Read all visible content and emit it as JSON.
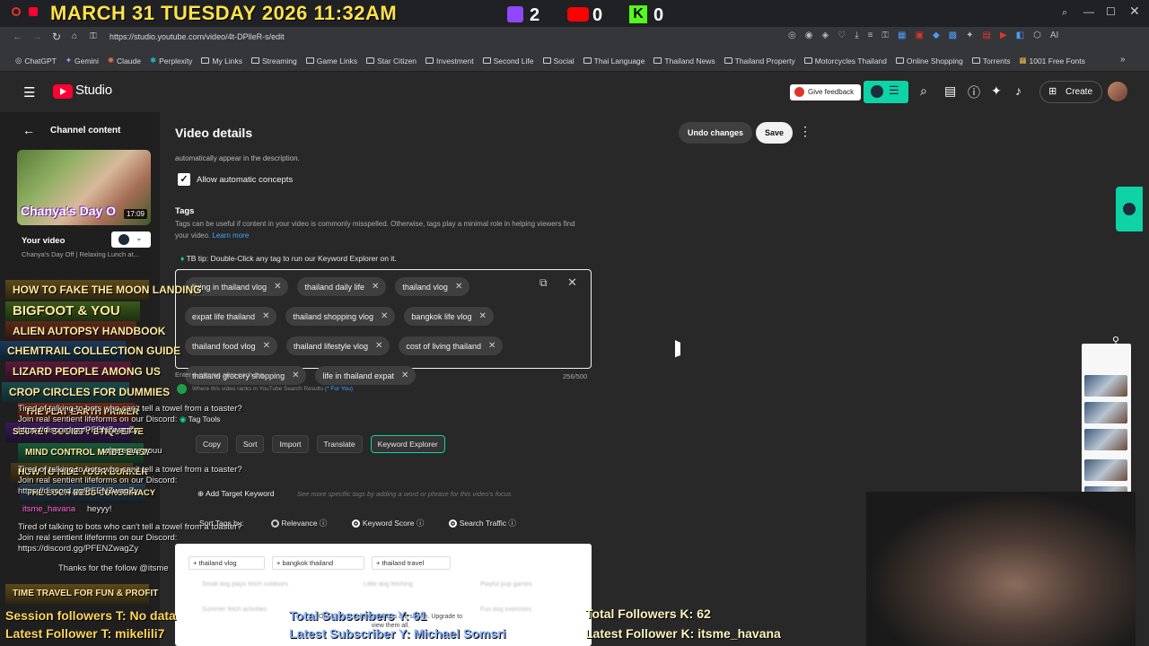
{
  "overlay": {
    "datetime": "MARCH 31 TUESDAY 2026 11:32AM",
    "twitch_count": "2",
    "youtube_count": "0",
    "kick_count": "0",
    "session_followers": "Session followers T: No data",
    "latest_follower_t": "Latest Follower T: mikelili7",
    "total_subscribers": "Total Subscribers Y: 61",
    "latest_subscriber": "Latest Subscriber Y: Michael Somsri",
    "total_followers_k": "Total Followers K: 62",
    "latest_follower_k": "Latest Follower K: itsme_havana"
  },
  "browser": {
    "url": "https://studio.youtube.com/video/4t-DPlleR-s/edit",
    "bookmarks": [
      "ChatGPT",
      "Gemini",
      "Claude",
      "Perplexity",
      "My Links",
      "Streaming",
      "Game Links",
      "Star Citizen",
      "Investment",
      "Second Life",
      "Social",
      "Thai Language",
      "Thailand News",
      "Thailand Property",
      "Motorcycles Thailand",
      "Online Shopping",
      "Torrents",
      "1001 Free Fonts"
    ]
  },
  "studio": {
    "logo_text": "Studio",
    "give_feedback": "Give feedback",
    "create": "Create",
    "channel_content": "Channel content",
    "your_video": "Your video",
    "video_title_short": "Chanya's Day Off | Relaxing Lunch at...",
    "thumb_caption": "Chanya's Day O",
    "thumb_duration": "17:09"
  },
  "details": {
    "title": "Video details",
    "undo": "Undo changes",
    "save": "Save",
    "auto_note": "automatically appear in the description.",
    "allow_concepts": "Allow automatic concepts",
    "tags_heading": "Tags",
    "tags_desc": "Tags can be useful if content in your video is commonly misspelled. Otherwise, tags play a minimal role in helping viewers find your video.",
    "learn_more": "Learn more",
    "tb_tip": "TB tip: Double-Click any tag to run our Keyword Explorer on it.",
    "tags": [
      "living in thailand vlog",
      "thailand daily life",
      "thailand vlog",
      "expat life thailand",
      "thailand shopping vlog",
      "bangkok life vlog",
      "thailand food vlog",
      "thailand lifestyle vlog",
      "cost of living thailand",
      "thailand grocery shopping",
      "life in thailand expat"
    ],
    "comma_hint": "Enter a comma after each tag",
    "counter": "256/500",
    "rank_note": "Where this video ranks in YouTube Search Results",
    "for_you": "(* For You)",
    "tag_tools": "Tag Tools",
    "tool_buttons": [
      "Copy",
      "Sort",
      "Import",
      "Translate",
      "Keyword Explorer"
    ],
    "add_target": "Add Target Keyword",
    "add_target_hint": "See more specific tags by adding a word or phrase for this video's focus",
    "sort_by": "Sort Tags by:",
    "sort_options": [
      "Relevance",
      "Keyword Score",
      "Search Traffic"
    ],
    "suggested": [
      "thailand vlog",
      "bangkok thailand",
      "thailand travel"
    ],
    "blurred_rows": [
      "Small dog plays fetch outdoors",
      "Little dog fetching",
      "Playful pup games",
      "Summer fetch activities",
      "Fun dog exercises"
    ],
    "upgrade_note": "Only 3 of 12 suggested tags are shown. Upgrade to view them all."
  },
  "chat": [
    {
      "user": "",
      "text": "Tired of talking to bots who can't tell a towel from a toaster? Join real sentient lifeforms on our Discord: https://discord.gg/PFENZwagZy"
    },
    {
      "user": "",
      "text": "where are youu"
    },
    {
      "user": "itsme_havana",
      "text": "heyyy!"
    },
    {
      "user": "",
      "text": "Thanks for the follow @itsme"
    }
  ],
  "books": [
    "HOW TO FAKE THE MOON LANDING",
    "BIGFOOT & YOU",
    "ALIEN AUTOPSY HANDBOOK",
    "CHEMTRAIL COLLECTION GUIDE",
    "LIZARD PEOPLE AMONG US",
    "CROP CIRCLES FOR DUMMIES",
    "THE FLAT EARTH PRIMER",
    "SECRET SOCIETY ETIQUETTE",
    "MIND CONTROL MADE EASY",
    "HOW TO HIDE YOUR BUNKER",
    "THE LOCH NESS CONSPIRACY",
    "TIME TRAVEL FOR FUN & PROFIT"
  ],
  "colors": {
    "accent": "#0dd3a7",
    "overlay_yellow": "#ffe24a",
    "yt_red": "#ff0033"
  }
}
